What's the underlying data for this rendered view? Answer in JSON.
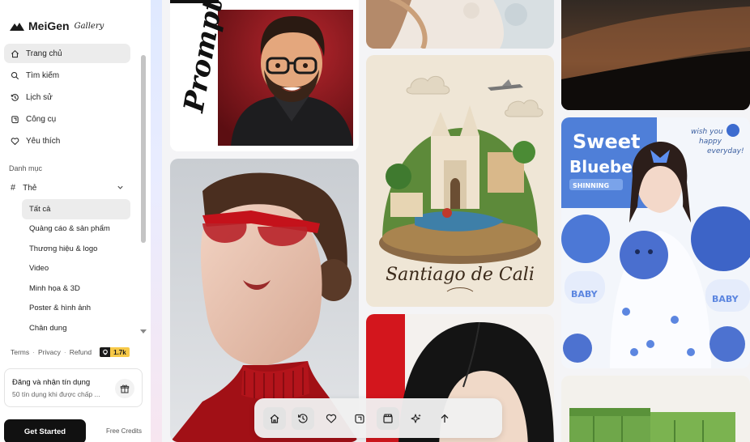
{
  "brand": {
    "name": "MeiGen",
    "sub": "Gallery"
  },
  "nav": [
    {
      "label": "Trang chủ",
      "icon": "home-icon",
      "active": true
    },
    {
      "label": "Tìm kiếm",
      "icon": "search-icon",
      "active": false
    },
    {
      "label": "Lịch sử",
      "icon": "history-icon",
      "active": false
    },
    {
      "label": "Công cụ",
      "icon": "tools-icon",
      "active": false
    },
    {
      "label": "Yêu thích",
      "icon": "heart-icon",
      "active": false
    }
  ],
  "category": {
    "section_label": "Danh mục",
    "tag_label": "Thẻ",
    "items": [
      {
        "label": "Tất cả",
        "active": true
      },
      {
        "label": "Quảng cáo & sản phẩm",
        "active": false
      },
      {
        "label": "Thương hiệu & logo",
        "active": false
      },
      {
        "label": "Video",
        "active": false
      },
      {
        "label": "Minh họa & 3D",
        "active": false
      },
      {
        "label": "Poster & hình ảnh",
        "active": false
      },
      {
        "label": "Chân dung",
        "active": false
      }
    ]
  },
  "footer": {
    "terms": "Terms",
    "privacy": "Privacy",
    "refund": "Refund",
    "github_count": "1.7k"
  },
  "credits": {
    "title": "Đăng và nhận tín dụng",
    "subtitle": "50 tín dụng khi được chấp ...",
    "get_started": "Get Started",
    "free_credits": "Free Credits"
  },
  "gallery": {
    "prompt_word": "Prompt",
    "santiago_caption": "Santiago de Cali",
    "blueberry_title_1": "Sweet",
    "blueberry_title_2": "Blueberry",
    "blueberry_ribbon": "SHINNING",
    "blueberry_note_1": "wish you",
    "blueberry_note_2": "happy",
    "blueberry_note_3": "everyday!",
    "baby_label": "BABY"
  },
  "toolbar": [
    {
      "icon": "home-icon"
    },
    {
      "icon": "history-icon"
    },
    {
      "icon": "heart-icon"
    },
    {
      "icon": "tools-icon"
    },
    {
      "icon": "video-icon"
    },
    {
      "icon": "sparkle-icon"
    },
    {
      "icon": "arrow-up-icon"
    }
  ],
  "colors": {
    "accent_dark": "#111111",
    "badge_yellow": "#f7c948",
    "active_bg": "#ececec"
  }
}
